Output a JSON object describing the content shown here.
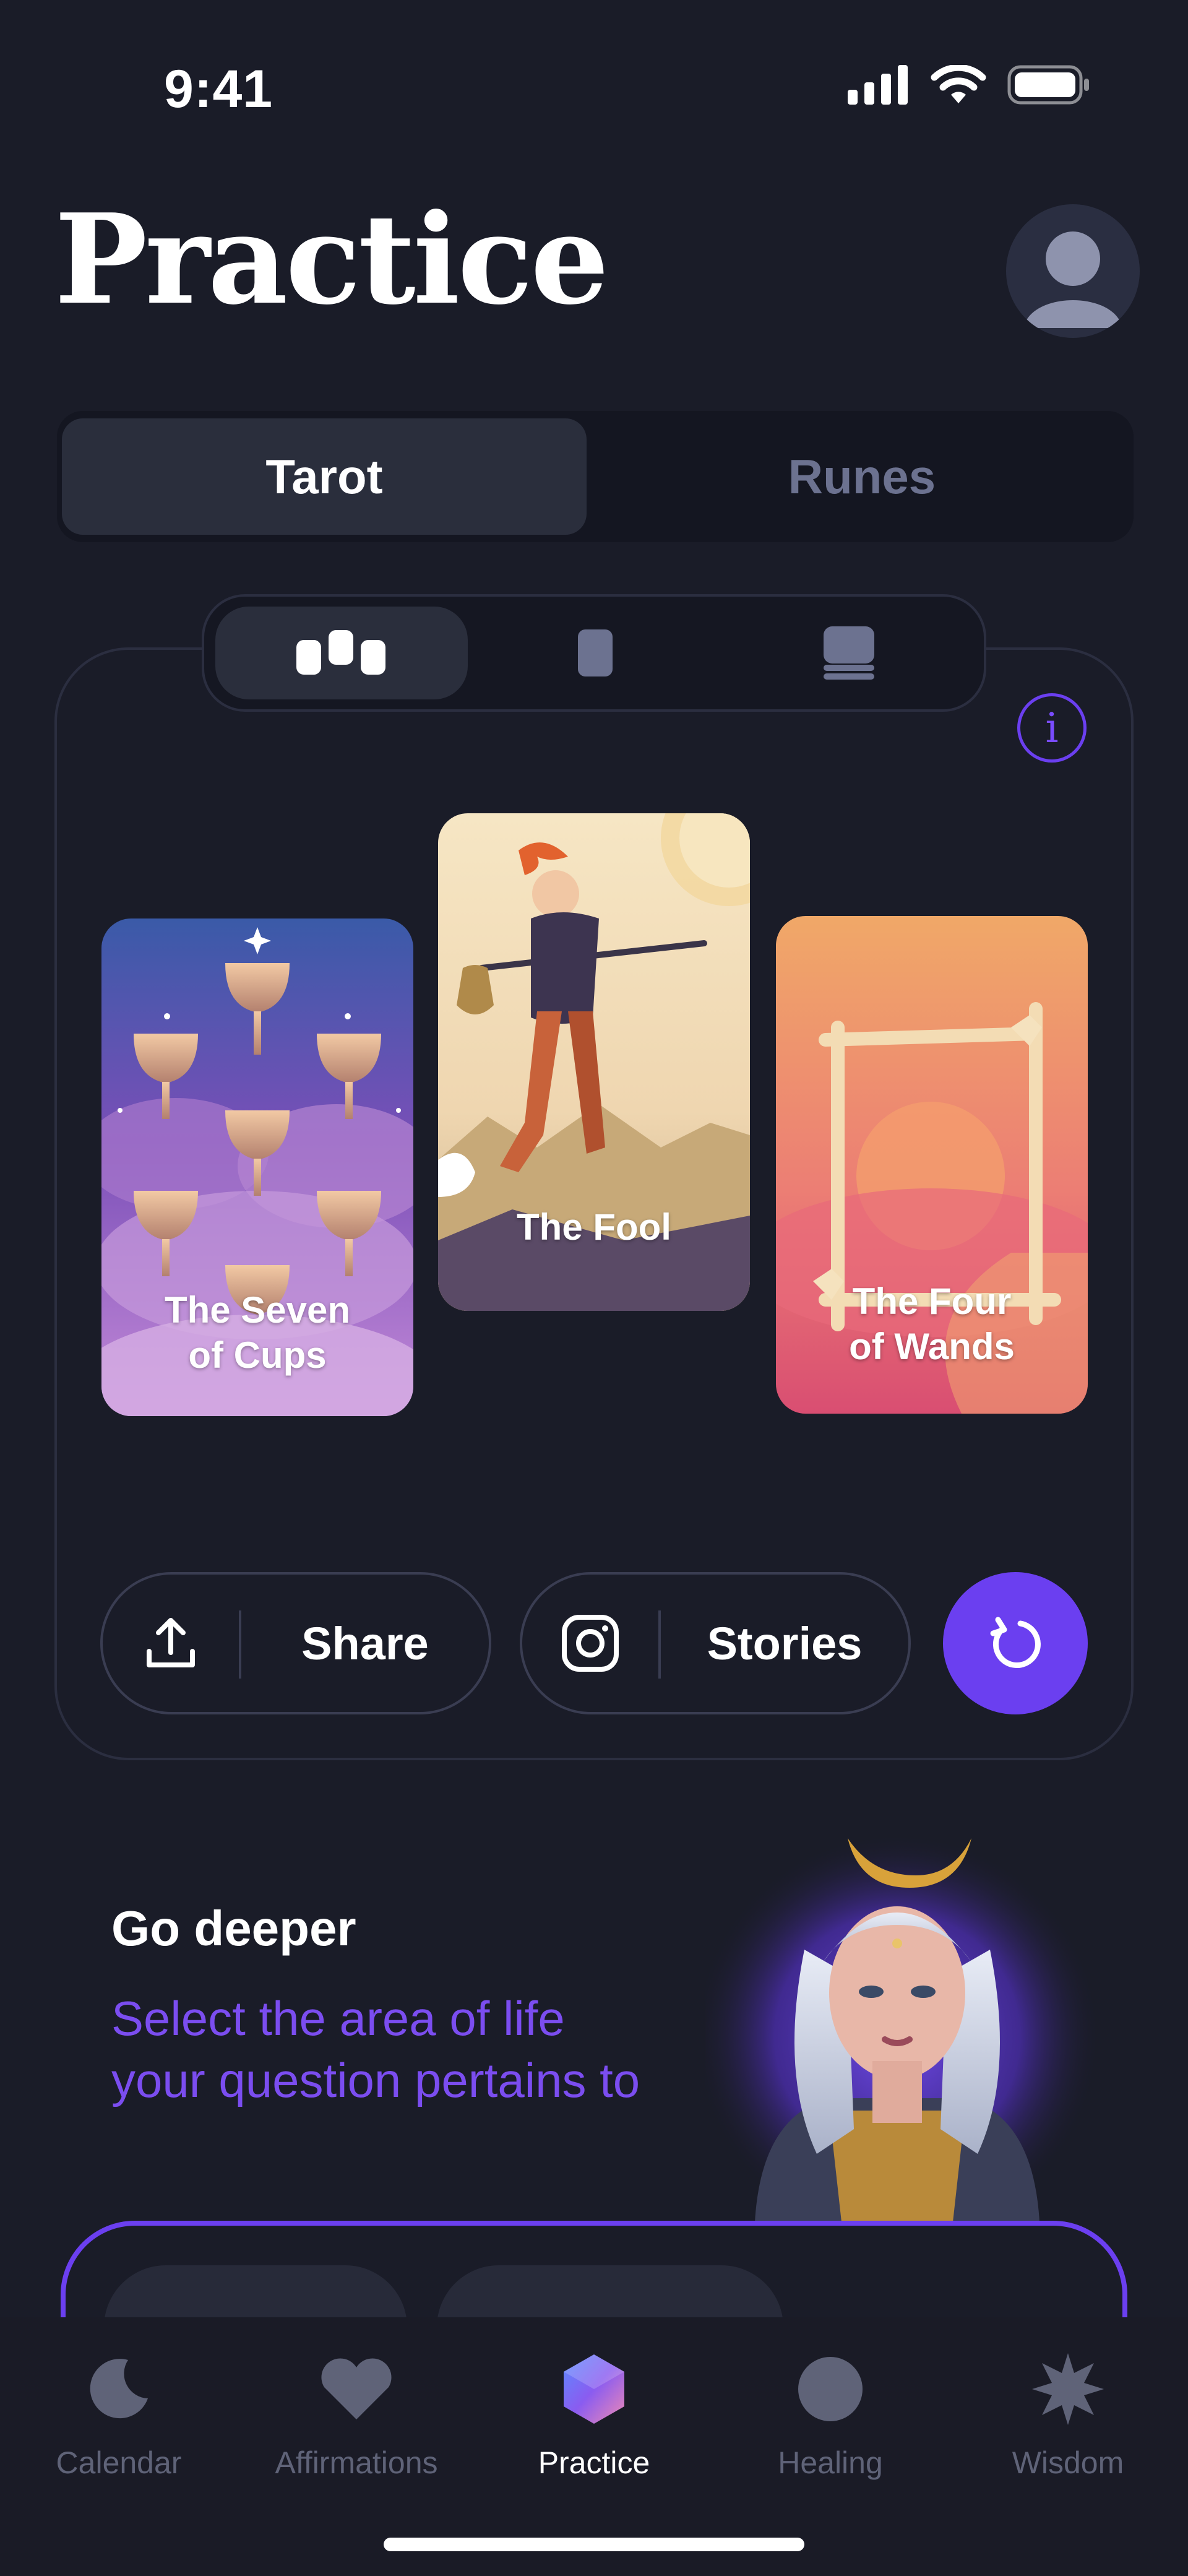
{
  "status_bar": {
    "time": "9:41"
  },
  "header": {
    "title": "Practice"
  },
  "segment": {
    "tabs": [
      "Tarot",
      "Runes"
    ],
    "active": "Tarot"
  },
  "layout_modes": [
    "spread-layout-icon",
    "single-card-icon",
    "deck-icon"
  ],
  "cards": [
    {
      "name": "The Seven\nof Cups",
      "line1": "The Seven",
      "line2": "of Cups"
    },
    {
      "name": "The Fool",
      "line1": "The Fool"
    },
    {
      "name": "The Four\nof Wands",
      "line1": "The Four",
      "line2": "of Wands"
    }
  ],
  "actions": {
    "share": "Share",
    "stories": "Stories"
  },
  "go_deeper": {
    "title": "Go deeper",
    "subtitle": "Select the area of life your question pertains to"
  },
  "tabbar": {
    "items": [
      {
        "label": "Calendar",
        "icon": "moon-icon"
      },
      {
        "label": "Affirmations",
        "icon": "heart-icon"
      },
      {
        "label": "Practice",
        "icon": "cube-icon",
        "active": true
      },
      {
        "label": "Healing",
        "icon": "circle-icon"
      },
      {
        "label": "Wisdom",
        "icon": "star-burst-icon"
      }
    ]
  },
  "colors": {
    "background": "#1a1c28",
    "accent": "#6b3ff0",
    "muted": "#6c7290"
  }
}
